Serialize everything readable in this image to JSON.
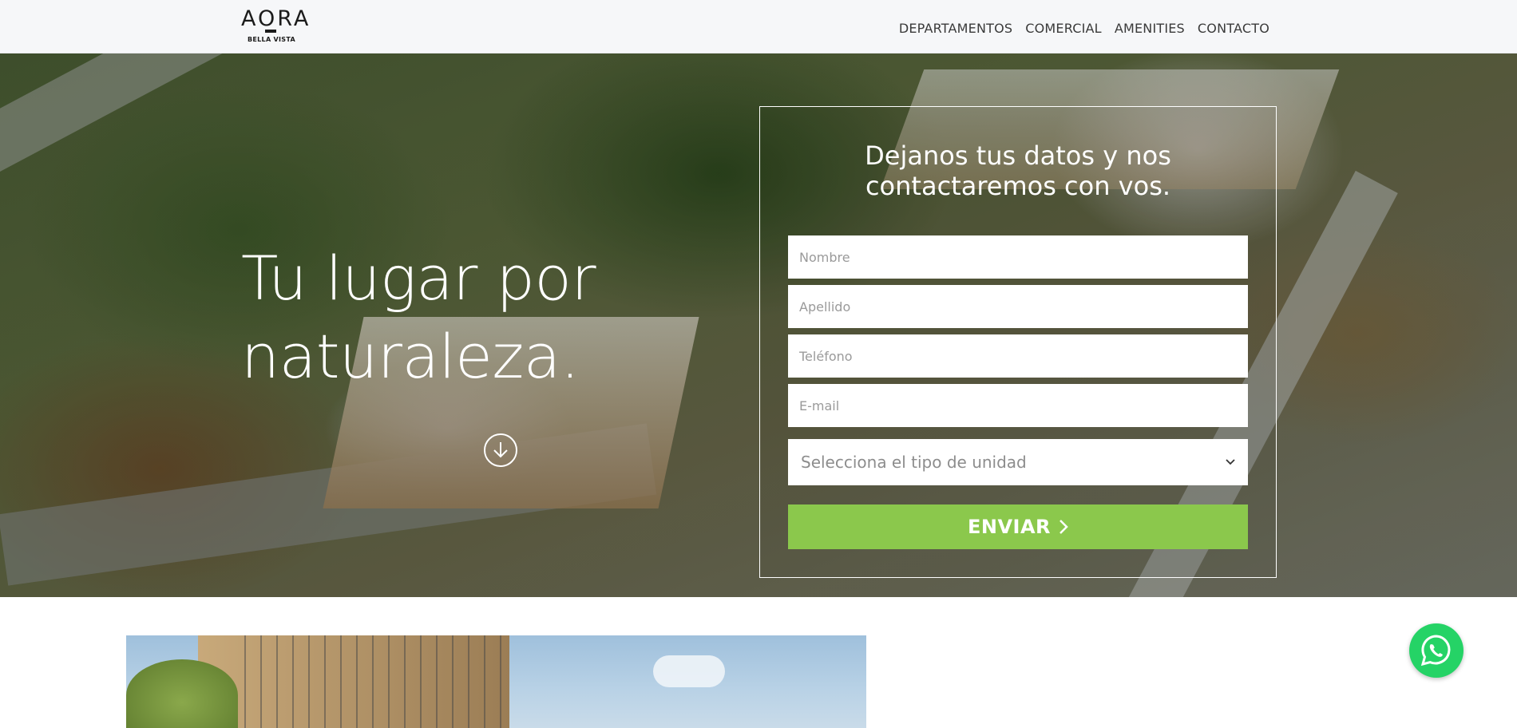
{
  "header": {
    "logo": {
      "name": "AORA",
      "subtitle": "BELLA VISTA"
    },
    "nav": [
      {
        "label": "DEPARTAMENTOS"
      },
      {
        "label": "COMERCIAL"
      },
      {
        "label": "AMENITIES"
      },
      {
        "label": "CONTACTO"
      }
    ]
  },
  "hero": {
    "title_line1": "Tu lugar por",
    "title_line2": "naturaleza.",
    "scroll_icon": "arrow-down-circle-icon"
  },
  "form": {
    "title_line1": "Dejanos tus datos y nos",
    "title_line2": "contactaremos con vos.",
    "fields": {
      "nombre": {
        "placeholder": "Nombre",
        "value": ""
      },
      "apellido": {
        "placeholder": "Apellido",
        "value": ""
      },
      "telefono": {
        "placeholder": "Teléfono",
        "value": ""
      },
      "email": {
        "placeholder": "E-mail",
        "value": ""
      }
    },
    "unit_select": {
      "selected": "Selecciona el tipo de unidad",
      "icon": "chevron-down-icon"
    },
    "submit": {
      "label": "ENVIAR",
      "icon": "chevron-right-icon"
    }
  },
  "colors": {
    "accent_green": "#8bc84c",
    "whatsapp_green": "#25d366",
    "header_bg": "#f6f7f9"
  },
  "floating": {
    "whatsapp_icon": "whatsapp-icon"
  }
}
